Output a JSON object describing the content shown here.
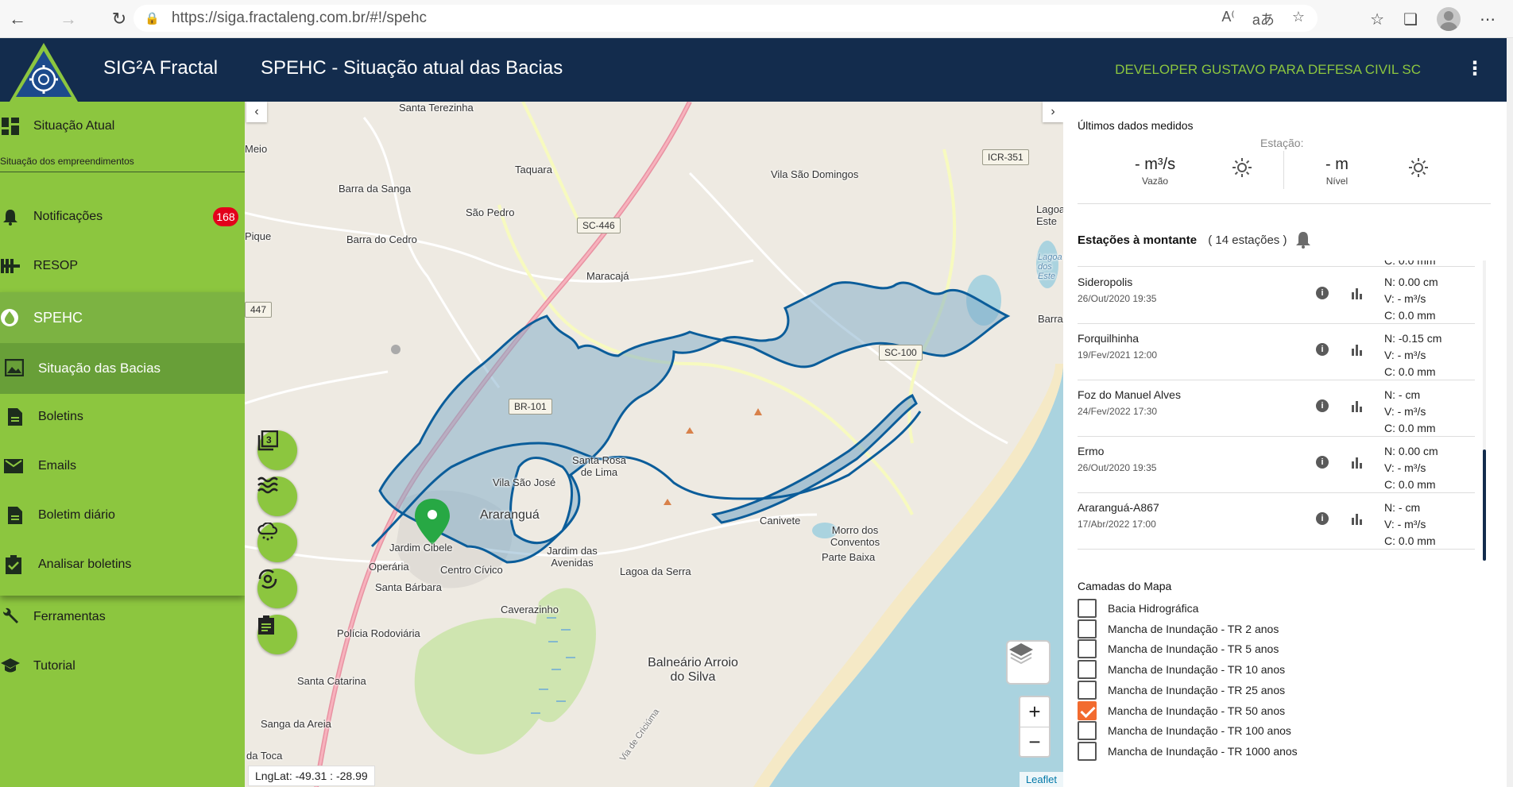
{
  "browser": {
    "url": "https://siga.fractaleng.com.br/#!/spehc"
  },
  "header": {
    "app_name": "SIG²A Fractal",
    "page_title": "SPEHC - Situação atual das Bacias",
    "user": "DEVELOPER GUSTAVO PARA DEFESA CIVIL SC",
    "bg_color": "#132c4d",
    "user_color": "#8cc63f"
  },
  "sidebar": {
    "color": "#8cc63f",
    "situacao_atual": "Situação Atual",
    "sub_caption": "Situação dos empreendimentos",
    "notificacoes": "Notificações",
    "notificacoes_badge": "168",
    "resop": "RESOP",
    "spehc": "SPEHC",
    "situacao_bacias": "Situação das Bacias",
    "boletins": "Boletins",
    "emails": "Emails",
    "boletim_diario": "Boletim diário",
    "analisar_boletins": "Analisar boletins",
    "ferramentas": "Ferramentas",
    "tutorial": "Tutorial"
  },
  "map": {
    "labels": {
      "santa_terezinha": "Santa Terezinha",
      "meio": "Meio",
      "taquara": "Taquara",
      "barra_da_sanga": "Barra da Sanga",
      "vila_sao_domingos": "Vila São Domingos",
      "sao_pedro": "São Pedro",
      "barra_do_cedro": "Barra do Cedro",
      "pique": "Pique",
      "maracaja": "Maracajá",
      "lagoa_este": "Lagoa Este",
      "lagoa_dos_este": "Lagoa dos Este",
      "barra": "Barra",
      "santa_rosa_de_lima": "Santa Rosa de Lima",
      "vila_sao_jose": "Vila São José",
      "ararangua": "Araranguá",
      "jardim_cibele": "Jardim Cibele",
      "jardim_das_avenidas": "Jardim das Avenidas",
      "lagoa_da_serra": "Lagoa da Serra",
      "canivete": "Canivete",
      "morro_dos_conventos": "Morro dos Conventos",
      "parte_baixa": "Parte Baixa",
      "operaria": "Operária",
      "centro_civico": "Centro Cívico",
      "santa_barbara": "Santa Bárbara",
      "caverazinho": "Caverazinho",
      "policia_rodoviaria": "Polícia Rodoviária",
      "balneario_arroio_do_silva": "Balneário Arroio do Silva",
      "santa_catarina": "Santa Catarina",
      "sanga_da_areia": "Sanga da Areia",
      "da_toca": "da Toca",
      "via_de_criciuma": "Via de Criciúma"
    },
    "shields": {
      "icr351": "ICR-351",
      "sc446": "SC-446",
      "n447": "447",
      "sc100": "SC-100",
      "br101": "BR-101"
    },
    "coords_readout": "LngLat: -49.31 : -28.99",
    "attribution": "Leaflet",
    "zoom_in": "+",
    "zoom_out": "−",
    "flood_color": "#0b5d9a"
  },
  "panel": {
    "ultimos_title": "Últimos dados medidos",
    "estacao_label": "Estação:",
    "vazao_value": "- m³/s",
    "vazao_label": "Vazão",
    "nivel_value": "- m",
    "nivel_label": "Nível",
    "montante_title": "Estações à montante",
    "montante_count": "( 14 estações )",
    "partial_row": "C: 0.0 mm",
    "stations": [
      {
        "name": "Sideropolis",
        "date": "26/Out/2020 19:35",
        "n": "N: 0.00 cm",
        "v": "V: - m³/s",
        "c": "C: 0.0 mm"
      },
      {
        "name": "Forquilhinha",
        "date": "19/Fev/2021 12:00",
        "n": "N: -0.15 cm",
        "v": "V: - m³/s",
        "c": "C: 0.0 mm"
      },
      {
        "name": "Foz do Manuel Alves",
        "date": "24/Fev/2022 17:30",
        "n": "N: - cm",
        "v": "V: - m³/s",
        "c": "C: 0.0 mm"
      },
      {
        "name": "Ermo",
        "date": "26/Out/2020 19:35",
        "n": "N: 0.00 cm",
        "v": "V: - m³/s",
        "c": "C: 0.0 mm"
      },
      {
        "name": "Araranguá-A867",
        "date": "17/Abr/2022 17:00",
        "n": "N: - cm",
        "v": "V: - m³/s",
        "c": "C: 0.0 mm"
      }
    ],
    "camadas_title": "Camadas do Mapa",
    "layers": [
      {
        "label": "Bacia Hidrográfica",
        "checked": false
      },
      {
        "label": "Mancha de Inundação - TR 2 anos",
        "checked": false
      },
      {
        "label": "Mancha de Inundação - TR 5 anos",
        "checked": false
      },
      {
        "label": "Mancha de Inundação - TR 10 anos",
        "checked": false
      },
      {
        "label": "Mancha de Inundação - TR 25 anos",
        "checked": false
      },
      {
        "label": "Mancha de Inundação - TR 50 anos",
        "checked": true
      },
      {
        "label": "Mancha de Inundação - TR 100 anos",
        "checked": false
      },
      {
        "label": "Mancha de Inundação - TR 1000 anos",
        "checked": false
      }
    ],
    "checkbox_color": "#f26b2f"
  }
}
